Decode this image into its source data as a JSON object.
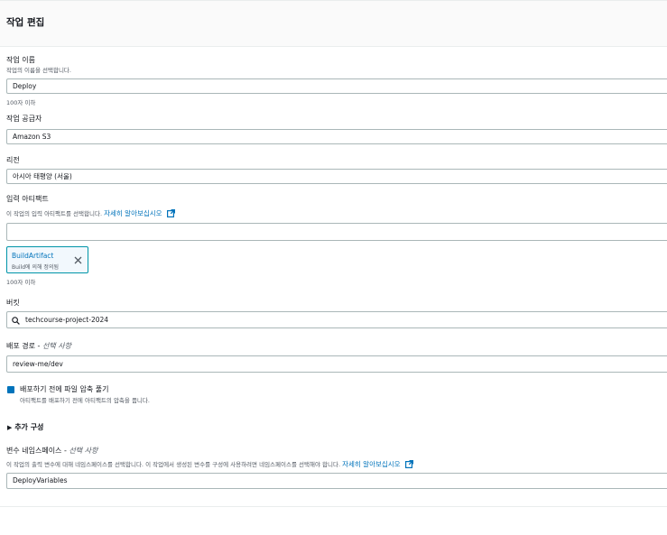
{
  "header": {
    "title": "작업 편집"
  },
  "action_name": {
    "label": "작업 이름",
    "description": "작업의 이름을 선택합니다.",
    "value": "Deploy",
    "hint": "100자 이하"
  },
  "action_provider": {
    "label": "작업 공급자",
    "value": "Amazon S3"
  },
  "region": {
    "label": "리전",
    "value": "아시아 태평양 (서울)"
  },
  "input_artifacts": {
    "label": "입력 아티팩트",
    "description": "이 작업의 입력 아티팩트를 선택합니다.",
    "learn_more": "자세히 알아보십시오",
    "value": "",
    "tag": {
      "name": "BuildArtifact",
      "sub": "Build에 의해 정의됨"
    },
    "hint": "100자 이하"
  },
  "bucket": {
    "label": "버킷",
    "value": "techcourse-project-2024"
  },
  "deploy_path": {
    "label": "배포 경로 - ",
    "optional": "선택 사항",
    "value": "review-me/dev"
  },
  "extract": {
    "label": "배포하기 전에 파일 압축 풀기",
    "description": "아티팩트를 배포하기 전에 아티팩트의 압축을 풉니다.",
    "checked": true
  },
  "additional_config": {
    "label": "추가 구성"
  },
  "namespace": {
    "label": "변수 네임스페이스 - ",
    "optional": "선택 사항",
    "description": "이 작업의 출력 변수에 대해 네임스페이스를 선택합니다. 이 작업에서 생성된 변수를 구성에 사용하려면 네임스페이스를 선택해야 합니다.",
    "learn_more": "자세히 알아보십시오",
    "value": "DeployVariables"
  },
  "colors": {
    "accent": "#0073bb",
    "border": "#aab7b8",
    "text": "#16191f",
    "muted": "#545b64"
  }
}
